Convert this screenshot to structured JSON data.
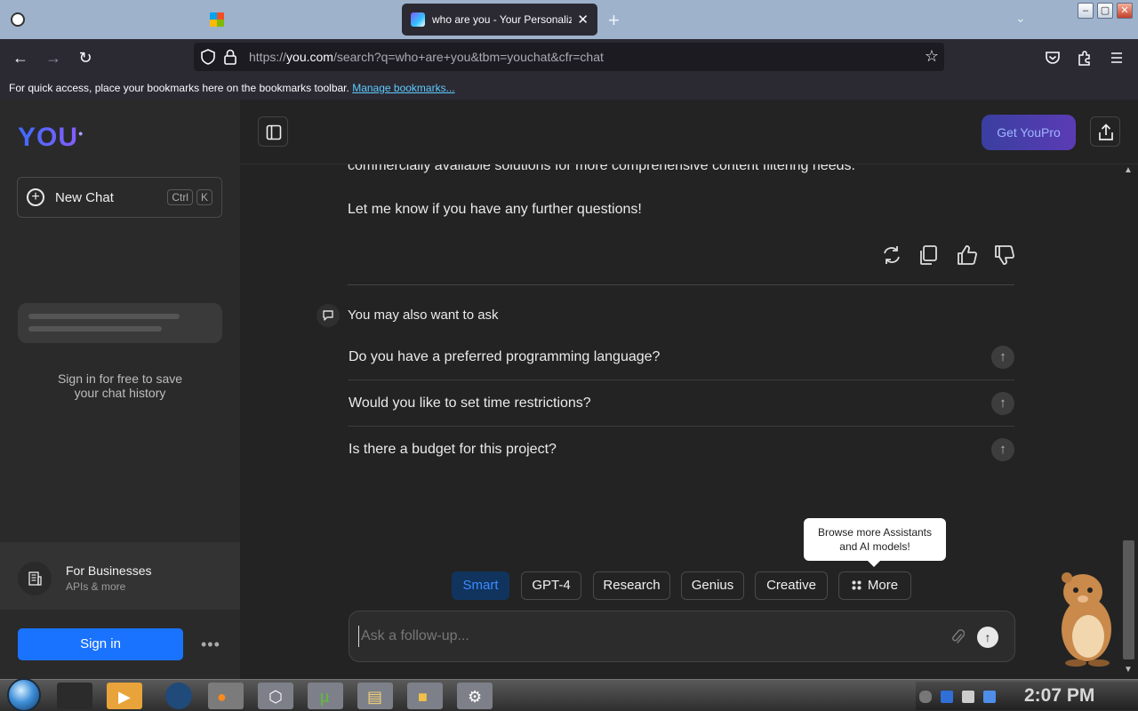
{
  "browser": {
    "tabs": [
      {
        "title": "",
        "active": false
      },
      {
        "title": "",
        "active": false
      },
      {
        "title": "who are you - Your Personalized",
        "active": true
      }
    ],
    "url_prefix": "https://",
    "url_domain": "you.com",
    "url_path": "/search?q=who+are+you&tbm=youchat&cfr=chat",
    "bookmarks_hint": "For quick access, place your bookmarks here on the bookmarks toolbar.",
    "bookmarks_link": "Manage bookmarks..."
  },
  "sidebar": {
    "logo": "YOU",
    "new_chat_label": "New Chat",
    "shortcut_keys": [
      "Ctrl",
      "K"
    ],
    "signin_note_line1": "Sign in for free to save",
    "signin_note_line2": "your chat history",
    "business_title": "For Businesses",
    "business_subtitle": "APIs & more",
    "signin_button": "Sign in"
  },
  "header": {
    "get_pro_label": "Get YouPro"
  },
  "chat": {
    "truncated_text": "commercially available solutions for more comprehensive content filtering needs.",
    "closing_text": "Let me know if you have any further questions!",
    "also_ask_title": "You may also want to ask",
    "suggestions": [
      "Do you have a preferred programming language?",
      "Would you like to set time restrictions?",
      "Is there a budget for this project?"
    ]
  },
  "modes": {
    "tooltip_line1": "Browse more Assistants",
    "tooltip_line2": "and AI models!",
    "items": [
      "Smart",
      "GPT-4",
      "Research",
      "Genius",
      "Creative",
      "More"
    ],
    "selected": "Smart"
  },
  "composer": {
    "placeholder": "Ask a follow-up..."
  },
  "taskbar": {
    "clock": "2:07 PM"
  },
  "colors": {
    "accent_blue": "#1a73ff",
    "smart_bg": "#10345e",
    "pro_gradient_start": "#3a3fa0",
    "pro_gradient_end": "#5b3bb5"
  }
}
